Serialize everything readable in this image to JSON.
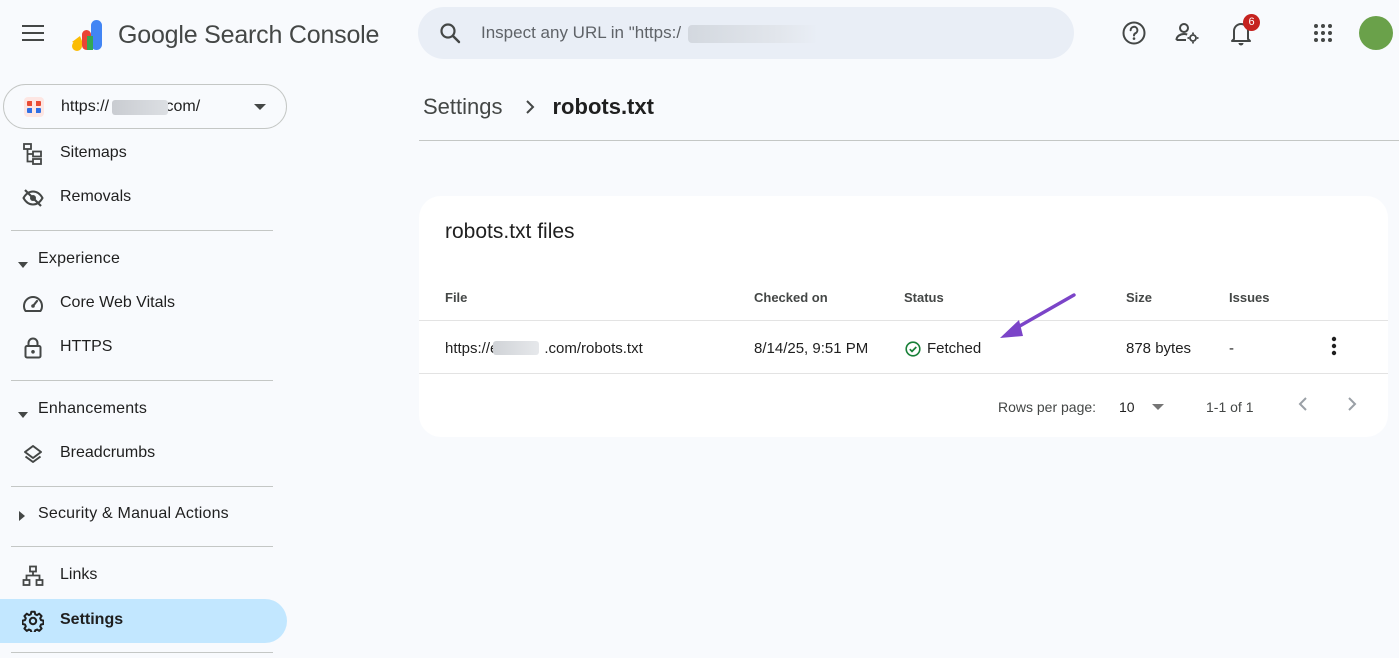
{
  "app": {
    "title": "Google Search Console"
  },
  "search": {
    "placeholder": "Inspect any URL in \"https:/"
  },
  "header": {
    "notification_count": "6"
  },
  "property": {
    "url_prefix": "https://",
    "url_suffix": ".com/"
  },
  "sidebar": {
    "items": [
      {
        "label": "Sitemaps",
        "icon": "sitemap-icon"
      },
      {
        "label": "Removals",
        "icon": "eye-off-icon"
      },
      {
        "label": "Core Web Vitals",
        "icon": "speed-gauge-icon"
      },
      {
        "label": "HTTPS",
        "icon": "lock-icon"
      },
      {
        "label": "Breadcrumbs",
        "icon": "layers-icon"
      },
      {
        "label": "Links",
        "icon": "links-icon"
      },
      {
        "label": "Settings",
        "icon": "gear-icon",
        "active": true
      }
    ],
    "sections": [
      {
        "label": "Experience",
        "expanded": true
      },
      {
        "label": "Enhancements",
        "expanded": true
      },
      {
        "label": "Security & Manual Actions",
        "expanded": false
      }
    ]
  },
  "breadcrumb": {
    "parent": "Settings",
    "current": "robots.txt"
  },
  "card": {
    "title": "robots.txt files",
    "columns": {
      "file": "File",
      "checked_on": "Checked on",
      "status": "Status",
      "size": "Size",
      "issues": "Issues"
    },
    "rows": [
      {
        "file_prefix": "https://e",
        "file_suffix": ".com/robots.txt",
        "checked_on": "8/14/25, 9:51 PM",
        "status": "Fetched",
        "size": "878 bytes",
        "issues": "-"
      }
    ],
    "pagination": {
      "rows_per_page_label": "Rows per page:",
      "rows_per_page": "10",
      "range": "1-1 of 1"
    }
  },
  "colors": {
    "accent": "#0b57d0",
    "active_nav": "#c2e7ff",
    "search_bg": "#e9eef6",
    "status_ok": "#188038",
    "annotation_arrow": "#7b44c8",
    "badge": "#c5221f"
  }
}
